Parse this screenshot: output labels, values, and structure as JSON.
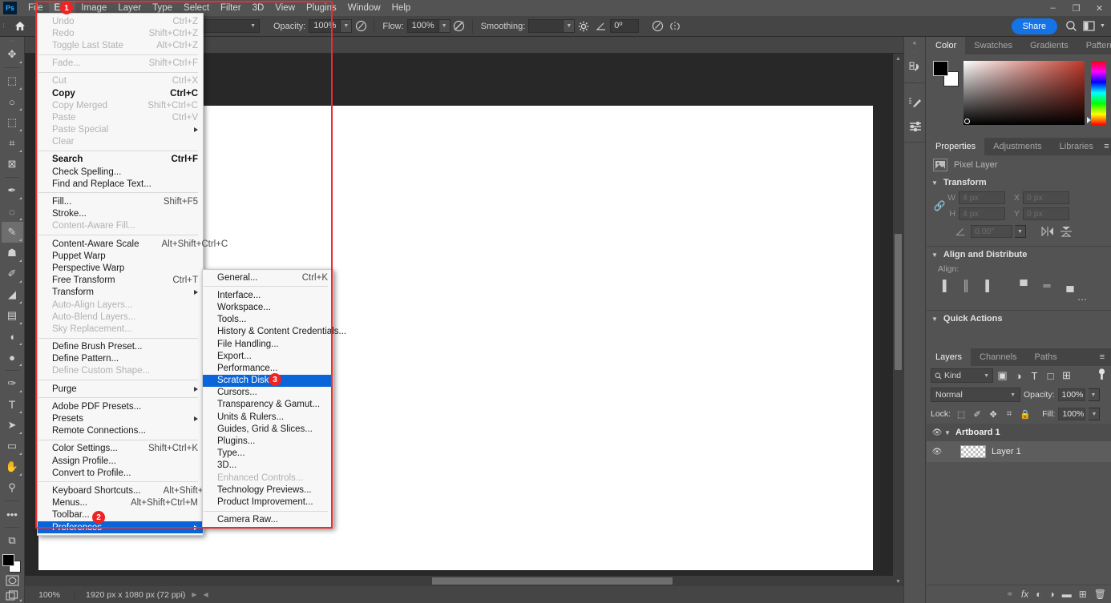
{
  "app": {
    "logo": "Ps",
    "accent": "#1473e6",
    "highlight": "#0a65d8",
    "annotation_color": "#ee2424"
  },
  "menubar": {
    "items": [
      {
        "label": "File",
        "active": false
      },
      {
        "label": "Edit",
        "active": true
      },
      {
        "label": "Image",
        "active": false
      },
      {
        "label": "Layer",
        "active": false
      },
      {
        "label": "Type",
        "active": false
      },
      {
        "label": "Select",
        "active": false
      },
      {
        "label": "Filter",
        "active": false
      },
      {
        "label": "3D",
        "active": false
      },
      {
        "label": "View",
        "active": false
      },
      {
        "label": "Plugins",
        "active": false
      },
      {
        "label": "Window",
        "active": false
      },
      {
        "label": "Help",
        "active": false
      }
    ],
    "window_controls": [
      "minimize",
      "maximize",
      "close"
    ]
  },
  "options_bar": {
    "home_icon": "home-icon",
    "brush_preset_caret": "chevron-down-icon",
    "opacity_label": "Opacity:",
    "opacity_value": "100%",
    "airbrush_icon": "airbrush-icon",
    "flow_label": "Flow:",
    "flow_value": "100%",
    "flow_pressure_icon": "flow-pressure-icon",
    "smoothing_label": "Smoothing:",
    "smoothing_value": "",
    "smoothing_gear_icon": "gear-icon",
    "angle_icon": "angle-icon",
    "angle_value": "0º",
    "tablet_pressure_icon": "tablet-pressure-icon",
    "symmetry_icon": "symmetry-icon",
    "share_label": "Share",
    "search_icon": "search-icon",
    "workspace_icon": "workspace-icon",
    "workspace_caret": "chevron-down-icon"
  },
  "toolbar": {
    "tools": [
      {
        "name": "move-tool",
        "glyph": "✥",
        "selected": false,
        "sub": true
      },
      {
        "name": "rectangular-marquee-tool",
        "glyph": "⬚",
        "selected": false,
        "sub": true
      },
      {
        "name": "lasso-tool",
        "glyph": "○",
        "selected": false,
        "sub": true
      },
      {
        "name": "object-selection-tool",
        "glyph": "⬚",
        "selected": false,
        "sub": true
      },
      {
        "name": "crop-tool",
        "glyph": "⌗",
        "selected": false,
        "sub": true
      },
      {
        "name": "frame-tool",
        "glyph": "⊠",
        "selected": false,
        "sub": false
      },
      {
        "name": "eyedropper-tool",
        "glyph": "✒",
        "selected": false,
        "sub": true
      },
      {
        "name": "spot-healing-brush-tool",
        "glyph": "◌",
        "selected": false,
        "sub": true
      },
      {
        "name": "brush-tool",
        "glyph": "✎",
        "selected": true,
        "sub": true
      },
      {
        "name": "clone-stamp-tool",
        "glyph": "☗",
        "selected": false,
        "sub": true
      },
      {
        "name": "history-brush-tool",
        "glyph": "✐",
        "selected": false,
        "sub": true
      },
      {
        "name": "eraser-tool",
        "glyph": "◢",
        "selected": false,
        "sub": true
      },
      {
        "name": "gradient-tool",
        "glyph": "▤",
        "selected": false,
        "sub": true
      },
      {
        "name": "blur-tool",
        "glyph": "◖",
        "selected": false,
        "sub": true
      },
      {
        "name": "dodge-tool",
        "glyph": "●",
        "selected": false,
        "sub": true
      },
      {
        "name": "pen-tool",
        "glyph": "✑",
        "selected": false,
        "sub": true
      },
      {
        "name": "horizontal-type-tool",
        "glyph": "T",
        "selected": false,
        "sub": true
      },
      {
        "name": "path-selection-tool",
        "glyph": "➤",
        "selected": false,
        "sub": true
      },
      {
        "name": "rectangle-tool",
        "glyph": "▭",
        "selected": false,
        "sub": true
      },
      {
        "name": "hand-tool",
        "glyph": "✋",
        "selected": false,
        "sub": true
      },
      {
        "name": "zoom-tool",
        "glyph": "⚲",
        "selected": false,
        "sub": false
      },
      {
        "name": "edit-toolbar-ellipsis",
        "glyph": "•••",
        "selected": false,
        "sub": false
      },
      {
        "name": "default-colors-icon",
        "glyph": "⧉",
        "selected": false,
        "sub": false
      }
    ],
    "foreground_color": "#000000",
    "background_color": "#ffffff",
    "quick_mask_icon": "quick-mask-icon",
    "screen_mode_icon": "screen-mode-icon"
  },
  "edit_menu": {
    "title": "Edit",
    "items": [
      {
        "label": "Undo",
        "accel": "Ctrl+Z",
        "state": "disabled"
      },
      {
        "label": "Redo",
        "accel": "Shift+Ctrl+Z",
        "state": "disabled"
      },
      {
        "label": "Toggle Last State",
        "accel": "Alt+Ctrl+Z",
        "state": "disabled"
      },
      {
        "type": "separator"
      },
      {
        "label": "Fade...",
        "accel": "Shift+Ctrl+F",
        "state": "disabled"
      },
      {
        "type": "separator"
      },
      {
        "label": "Cut",
        "accel": "Ctrl+X",
        "state": "disabled"
      },
      {
        "label": "Copy",
        "accel": "Ctrl+C",
        "state": "bold"
      },
      {
        "label": "Copy Merged",
        "accel": "Shift+Ctrl+C",
        "state": "disabled"
      },
      {
        "label": "Paste",
        "accel": "Ctrl+V",
        "state": "disabled"
      },
      {
        "label": "Paste Special",
        "accel": "",
        "state": "disabled",
        "submenu": true
      },
      {
        "label": "Clear",
        "accel": "",
        "state": "disabled"
      },
      {
        "type": "separator"
      },
      {
        "label": "Search",
        "accel": "Ctrl+F",
        "state": "bold"
      },
      {
        "label": "Check Spelling...",
        "accel": "",
        "state": "normal"
      },
      {
        "label": "Find and Replace Text...",
        "accel": "",
        "state": "normal"
      },
      {
        "type": "separator"
      },
      {
        "label": "Fill...",
        "accel": "Shift+F5",
        "state": "normal"
      },
      {
        "label": "Stroke...",
        "accel": "",
        "state": "normal"
      },
      {
        "label": "Content-Aware Fill...",
        "accel": "",
        "state": "disabled"
      },
      {
        "type": "separator"
      },
      {
        "label": "Content-Aware Scale",
        "accel": "Alt+Shift+Ctrl+C",
        "state": "normal"
      },
      {
        "label": "Puppet Warp",
        "accel": "",
        "state": "normal"
      },
      {
        "label": "Perspective Warp",
        "accel": "",
        "state": "normal"
      },
      {
        "label": "Free Transform",
        "accel": "Ctrl+T",
        "state": "normal"
      },
      {
        "label": "Transform",
        "accel": "",
        "state": "normal",
        "submenu": true
      },
      {
        "label": "Auto-Align Layers...",
        "accel": "",
        "state": "disabled"
      },
      {
        "label": "Auto-Blend Layers...",
        "accel": "",
        "state": "disabled"
      },
      {
        "label": "Sky Replacement...",
        "accel": "",
        "state": "disabled"
      },
      {
        "type": "separator"
      },
      {
        "label": "Define Brush Preset...",
        "accel": "",
        "state": "normal"
      },
      {
        "label": "Define Pattern...",
        "accel": "",
        "state": "normal"
      },
      {
        "label": "Define Custom Shape...",
        "accel": "",
        "state": "disabled"
      },
      {
        "type": "separator"
      },
      {
        "label": "Purge",
        "accel": "",
        "state": "normal",
        "submenu": true
      },
      {
        "type": "separator"
      },
      {
        "label": "Adobe PDF Presets...",
        "accel": "",
        "state": "normal"
      },
      {
        "label": "Presets",
        "accel": "",
        "state": "normal",
        "submenu": true
      },
      {
        "label": "Remote Connections...",
        "accel": "",
        "state": "normal"
      },
      {
        "type": "separator"
      },
      {
        "label": "Color Settings...",
        "accel": "Shift+Ctrl+K",
        "state": "normal"
      },
      {
        "label": "Assign Profile...",
        "accel": "",
        "state": "normal"
      },
      {
        "label": "Convert to Profile...",
        "accel": "",
        "state": "normal"
      },
      {
        "type": "separator"
      },
      {
        "label": "Keyboard Shortcuts...",
        "accel": "Alt+Shift+Ctrl+K",
        "state": "normal"
      },
      {
        "label": "Menus...",
        "accel": "Alt+Shift+Ctrl+M",
        "state": "normal"
      },
      {
        "label": "Toolbar...",
        "accel": "",
        "state": "normal"
      },
      {
        "label": "Preferences",
        "accel": "",
        "state": "highlighted",
        "submenu": true
      }
    ]
  },
  "preferences_menu": {
    "title": "Preferences",
    "items": [
      {
        "label": "General...",
        "accel": "Ctrl+K",
        "state": "normal"
      },
      {
        "type": "separator"
      },
      {
        "label": "Interface...",
        "accel": "",
        "state": "normal"
      },
      {
        "label": "Workspace...",
        "accel": "",
        "state": "normal"
      },
      {
        "label": "Tools...",
        "accel": "",
        "state": "normal"
      },
      {
        "label": "History & Content Credentials...",
        "accel": "",
        "state": "normal"
      },
      {
        "label": "File Handling...",
        "accel": "",
        "state": "normal"
      },
      {
        "label": "Export...",
        "accel": "",
        "state": "normal"
      },
      {
        "label": "Performance...",
        "accel": "",
        "state": "normal"
      },
      {
        "label": "Scratch Disks...",
        "accel": "",
        "state": "highlighted"
      },
      {
        "label": "Cursors...",
        "accel": "",
        "state": "normal"
      },
      {
        "label": "Transparency & Gamut...",
        "accel": "",
        "state": "normal"
      },
      {
        "label": "Units & Rulers...",
        "accel": "",
        "state": "normal"
      },
      {
        "label": "Guides, Grid & Slices...",
        "accel": "",
        "state": "normal"
      },
      {
        "label": "Plugins...",
        "accel": "",
        "state": "normal"
      },
      {
        "label": "Type...",
        "accel": "",
        "state": "normal"
      },
      {
        "label": "3D...",
        "accel": "",
        "state": "normal"
      },
      {
        "label": "Enhanced Controls...",
        "accel": "",
        "state": "disabled"
      },
      {
        "label": "Technology Previews...",
        "accel": "",
        "state": "normal"
      },
      {
        "label": "Product Improvement...",
        "accel": "",
        "state": "normal"
      },
      {
        "type": "separator"
      },
      {
        "label": "Camera Raw...",
        "accel": "",
        "state": "normal"
      }
    ]
  },
  "annotations": {
    "badges": [
      {
        "number": "1",
        "target": "edit-menu-title"
      },
      {
        "number": "2",
        "target": "preferences-menu-item"
      },
      {
        "number": "3",
        "target": "scratch-disks-menu-item"
      }
    ]
  },
  "dock_icons": {
    "collapse_icon": "chevron-double-left-icon",
    "groups": [
      [
        {
          "name": "history-panel-icon",
          "glyph": "↺"
        }
      ],
      [
        {
          "name": "brush-settings-panel-icon",
          "glyph": "✎"
        },
        {
          "name": "adjustments-panel-icon",
          "glyph": "☲"
        }
      ]
    ]
  },
  "color_panel": {
    "tabs": [
      {
        "label": "Color",
        "active": true
      },
      {
        "label": "Swatches",
        "active": false
      },
      {
        "label": "Gradients",
        "active": false
      },
      {
        "label": "Patterns",
        "active": false
      }
    ],
    "menu_icon": "panel-menu-icon",
    "foreground_color": "#000000",
    "background_color": "#ffffff"
  },
  "properties_panel": {
    "tabs": [
      {
        "label": "Properties",
        "active": true
      },
      {
        "label": "Adjustments",
        "active": false
      },
      {
        "label": "Libraries",
        "active": false
      }
    ],
    "menu_icon": "panel-menu-icon",
    "layer_type": "Pixel Layer",
    "layer_type_icon": "pixel-layer-icon",
    "transform": {
      "title": "Transform",
      "link_icon": "link-aspect-ratio-icon",
      "w_label": "W",
      "w_value": "4 px",
      "h_label": "H",
      "h_value": "4 px",
      "x_label": "X",
      "x_value": "0 px",
      "y_label": "Y",
      "y_value": "0 px",
      "angle_icon": "angle-icon",
      "angle_value": "0.00°",
      "flip_horizontal_icon": "flip-horizontal-icon",
      "flip_vertical_icon": "flip-vertical-icon"
    },
    "align": {
      "title": "Align and Distribute",
      "label": "Align:",
      "buttons": [
        {
          "name": "align-left-icon",
          "glyph": "▐"
        },
        {
          "name": "align-horizontal-center-icon",
          "glyph": "║"
        },
        {
          "name": "align-right-icon",
          "glyph": "▌"
        },
        {
          "name": "align-top-icon",
          "glyph": "▀"
        },
        {
          "name": "align-vertical-center-icon",
          "glyph": "═"
        },
        {
          "name": "align-bottom-icon",
          "glyph": "▄"
        }
      ],
      "more_icon": "more-options-icon"
    },
    "quick_actions": {
      "title": "Quick Actions"
    }
  },
  "layers_panel": {
    "tabs": [
      {
        "label": "Layers",
        "active": true
      },
      {
        "label": "Channels",
        "active": false
      },
      {
        "label": "Paths",
        "active": false
      }
    ],
    "menu_icon": "panel-menu-icon",
    "filter": {
      "search_icon": "search-icon",
      "kind_label": "Kind",
      "caret": "chevron-down-icon",
      "type_filters": [
        {
          "name": "filter-pixel-icon",
          "glyph": "▣"
        },
        {
          "name": "filter-adjustment-icon",
          "glyph": "◑"
        },
        {
          "name": "filter-type-icon",
          "glyph": "T"
        },
        {
          "name": "filter-shape-icon",
          "glyph": "□"
        },
        {
          "name": "filter-smart-object-icon",
          "glyph": "⊞"
        }
      ],
      "toggle_icon": "filter-toggle-icon"
    },
    "blend_mode": "Normal",
    "blend_caret": "chevron-down-icon",
    "opacity_label": "Opacity:",
    "opacity_value": "100%",
    "opacity_caret": "chevron-down-icon",
    "lock_label": "Lock:",
    "lock_buttons": [
      {
        "name": "lock-transparent-pixels-icon",
        "glyph": "⬚"
      },
      {
        "name": "lock-image-pixels-icon",
        "glyph": "✐"
      },
      {
        "name": "lock-position-icon",
        "glyph": "✥"
      },
      {
        "name": "lock-artboard-nesting-icon",
        "glyph": "⌗"
      },
      {
        "name": "lock-all-icon",
        "glyph": "🔒"
      }
    ],
    "fill_label": "Fill:",
    "fill_value": "100%",
    "fill_caret": "chevron-down-icon",
    "rows": [
      {
        "name": "Artboard 1",
        "type": "group",
        "visible": true,
        "selected": false,
        "expanded": false
      },
      {
        "name": "Layer 1",
        "type": "layer",
        "visible": true,
        "selected": true,
        "thumbnail": "transparent-checkerboard"
      }
    ],
    "footer_buttons": [
      {
        "name": "link-layers-icon",
        "glyph": "⚭",
        "enabled": false
      },
      {
        "name": "layer-style-fx-icon",
        "glyph": "fx",
        "enabled": true
      },
      {
        "name": "add-layer-mask-icon",
        "glyph": "◐",
        "enabled": true
      },
      {
        "name": "new-adjustment-layer-icon",
        "glyph": "◑",
        "enabled": true
      },
      {
        "name": "new-group-icon",
        "glyph": "▬",
        "enabled": true
      },
      {
        "name": "new-layer-icon",
        "glyph": "⊞",
        "enabled": true
      },
      {
        "name": "delete-layer-icon",
        "glyph": "🗑",
        "enabled": true
      }
    ]
  },
  "status_bar": {
    "zoom_level": "100%",
    "document_info": "1920 px x 1080 px (72 ppi)",
    "expand_icon": "chevron-right-icon",
    "collapse_icon": "chevron-left-icon"
  },
  "canvas": {
    "document_width": 1920,
    "document_height": 1080,
    "background": "#ffffff"
  }
}
